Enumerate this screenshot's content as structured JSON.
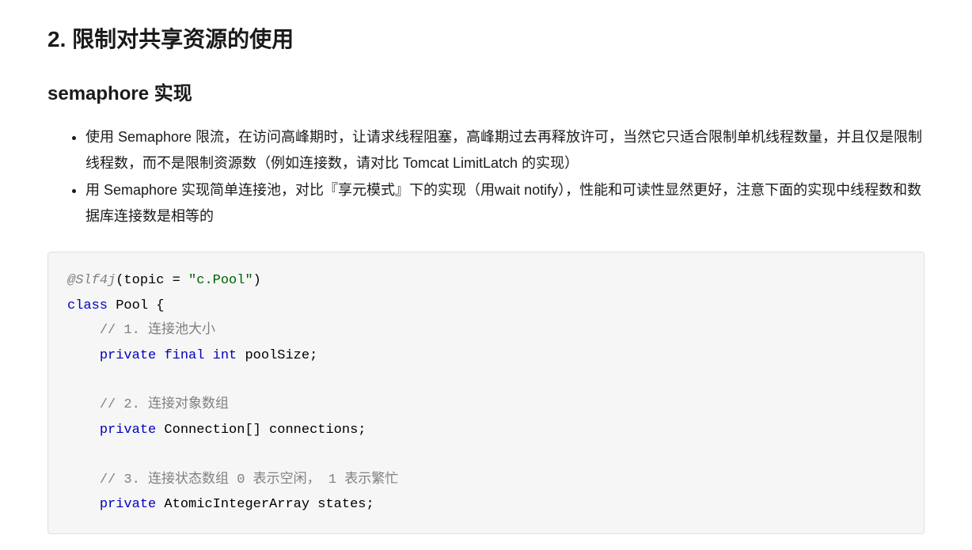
{
  "heading": "2. 限制对共享资源的使用",
  "subheading": "semaphore 实现",
  "bullets": [
    "使用 Semaphore 限流，在访问高峰期时，让请求线程阻塞，高峰期过去再释放许可，当然它只适合限制单机线程数量，并且仅是限制线程数，而不是限制资源数（例如连接数，请对比 Tomcat LimitLatch 的实现）",
    "用  Semaphore 实现简单连接池，对比『享元模式』下的实现（用wait notify），性能和可读性显然更好，注意下面的实现中线程数和数据库连接数是相等的"
  ],
  "code": {
    "annotation_name": "@Slf4j",
    "annotation_open": "(",
    "annotation_attr": "topic = ",
    "annotation_value": "\"c.Pool\"",
    "annotation_close": ")",
    "kw_class": "class",
    "class_name": "Pool",
    "brace_open": " {",
    "comment1": "// 1. 连接池大小",
    "kw_private1": "private",
    "kw_final": "final",
    "kw_int": "int",
    "field1": " poolSize;",
    "comment2": "// 2. 连接对象数组",
    "kw_private2": "private",
    "type_conn": " Connection[] connections;",
    "comment3": "// 3. 连接状态数组 0 表示空闲， 1 表示繁忙",
    "kw_private3": "private",
    "type_states": " AtomicIntegerArray states;"
  }
}
